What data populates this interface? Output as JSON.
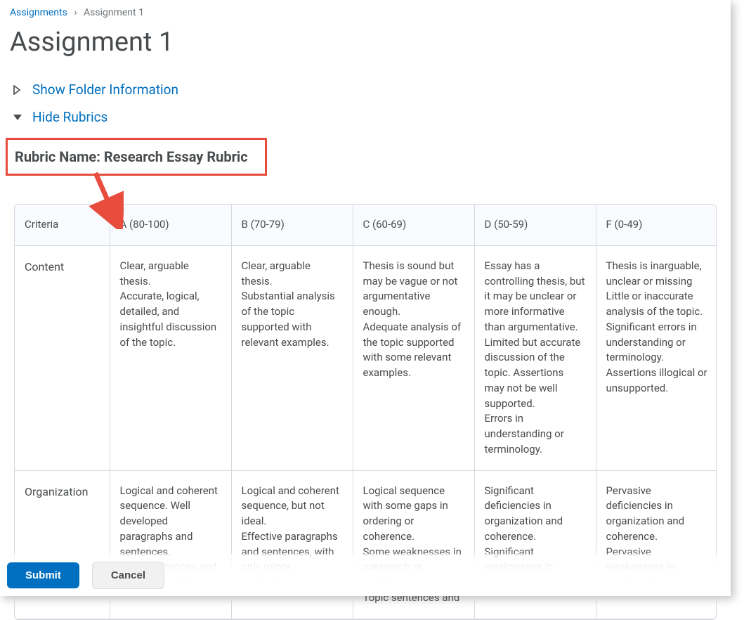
{
  "breadcrumb": {
    "parent": "Assignments",
    "separator": "›",
    "current": "Assignment 1"
  },
  "page_title": "Assignment 1",
  "folder_info_toggle": "Show Folder Information",
  "rubrics_toggle": "Hide Rubrics",
  "rubric_name_label": "Rubric Name: Research Essay Rubric",
  "headers": {
    "criteria": "Criteria",
    "levels": [
      "A (80-100)",
      "B (70-79)",
      "C (60-69)",
      "D (50-59)",
      "F (0-49)"
    ]
  },
  "rows": [
    {
      "name": "Content",
      "cells": [
        "Clear, arguable thesis.\nAccurate, logical, detailed, and insightful discussion of the topic.",
        "Clear, arguable thesis.\nSubstantial analysis of the topic supported with relevant examples.",
        "Thesis is sound but may be vague or not argumentative enough.\nAdequate analysis of the topic supported with some relevant examples.",
        "Essay has a controlling thesis, but it may be unclear or more informative than argumentative.\nLimited but accurate discussion of the topic. Assertions may not be well supported.\nErrors in understanding or terminology.",
        "Thesis is inarguable, unclear or missing\nLittle or inaccurate analysis of the topic.\nSignificant errors in understanding or terminology.\nAssertions illogical or unsupported."
      ]
    },
    {
      "name": "Organization",
      "cells": [
        "Logical and coherent sequence. Well developed paragraphs and sentences.\nTopic sentences and transitions reinforce",
        "Logical and coherent sequence, but not ideal.\nEffective paragraphs and sentences, with only minor weaknesses.",
        "Logical sequence with some gaps in ordering or coherence.\nSome weaknesses in paragraph or sentence structure.\nTopic sentences and",
        "Significant deficiencies in organization and coherence.\nSignificant weaknesses in paragraph or",
        "Pervasive deficiencies in organization and coherence.\nPervasive weaknesses in paragraph or"
      ]
    }
  ],
  "buttons": {
    "submit": "Submit",
    "cancel": "Cancel"
  }
}
